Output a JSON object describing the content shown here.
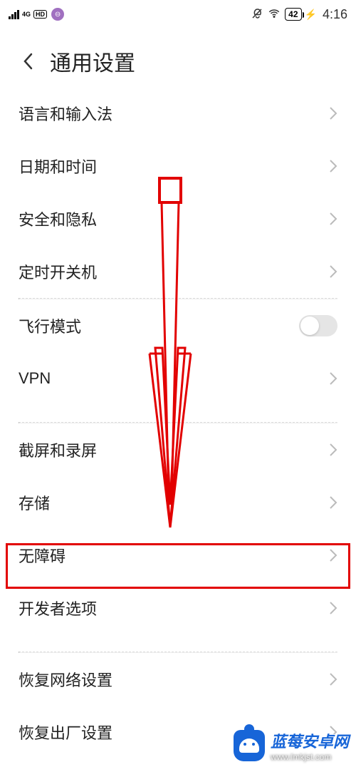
{
  "status_bar": {
    "network_type": "4G",
    "hd_badge": "HD",
    "battery_percent": "42",
    "time": "4:16"
  },
  "header": {
    "title": "通用设置"
  },
  "rows": {
    "language_input": "语言和输入法",
    "date_time": "日期和时间",
    "security_privacy": "安全和隐私",
    "scheduled_power": "定时开关机",
    "airplane_mode": "飞行模式",
    "vpn": "VPN",
    "screenshot_record": "截屏和录屏",
    "storage": "存储",
    "accessibility": "无障碍",
    "developer_options": "开发者选项",
    "reset_network": "恢复网络设置",
    "factory_reset": "恢复出厂设置"
  },
  "highlight": {
    "target_row": "accessibility"
  },
  "watermark": {
    "title": "蓝莓安卓网",
    "url": "www.lmkjst.com"
  }
}
